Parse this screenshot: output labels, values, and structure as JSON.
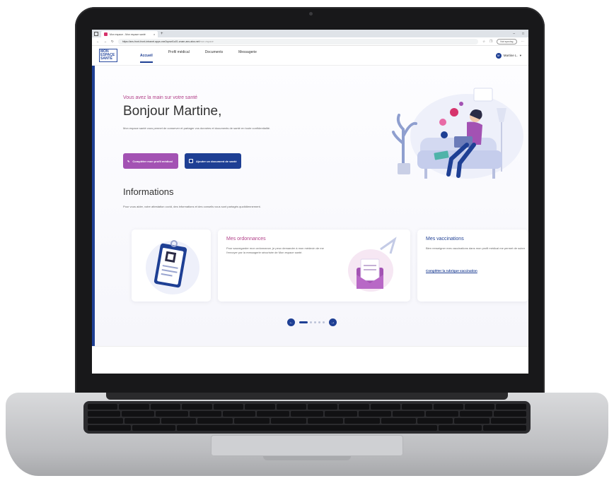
{
  "browser": {
    "tab_title": "Mon espace - Mon espace santé",
    "tab_close": "x",
    "new_tab": "+",
    "window_controls": [
      "–",
      "□"
    ],
    "url_main": "https://ans-front-front-intranet.apps.one2opsnt1u01.cnam-ans.atos.net",
    "url_path": "/mon-espace",
    "sync_label": "Not syncing"
  },
  "app": {
    "logo_lines": [
      "MON",
      "ESPACE",
      "SANTÉ"
    ],
    "nav": [
      {
        "label": "Accueil",
        "active": true
      },
      {
        "label": "Profil médical",
        "active": false
      },
      {
        "label": "Documents",
        "active": false
      },
      {
        "label": "Messagerie",
        "active": false
      }
    ],
    "user_initial": "M",
    "user_name": "Martine L."
  },
  "hero": {
    "kicker": "Vous avez la main sur votre santé",
    "greeting": "Bonjour Martine,",
    "intro": "Mon espace santé vous permet de conserver et partager vos données et documents de santé en toute confidentialité.",
    "button_profile": "Compléter mon profil médical",
    "button_document": "Ajouter un document de santé"
  },
  "informations": {
    "title": "Informations",
    "subtitle": "Pour vous aider, votre attestation covid, des informations et des conseils vous sont partagés quotidiennement.",
    "cards": [
      {
        "title": "Mes ordonnances",
        "text": "Pour sauvegarder mon ordonnance, je peux demander à mon médecin de me l'envoyer par la messagerie sécurisée de Mon espace santé."
      },
      {
        "title": "Mes vaccinations",
        "text": "Bien renseigner mes vaccinations dans mon profil médical me permet de suivre facilement mes dates de rappel.",
        "link": "Compléter la rubrique vaccination"
      }
    ]
  },
  "colors": {
    "primary": "#1e3f94",
    "accent": "#a352b3",
    "kicker": "#b13f88"
  }
}
